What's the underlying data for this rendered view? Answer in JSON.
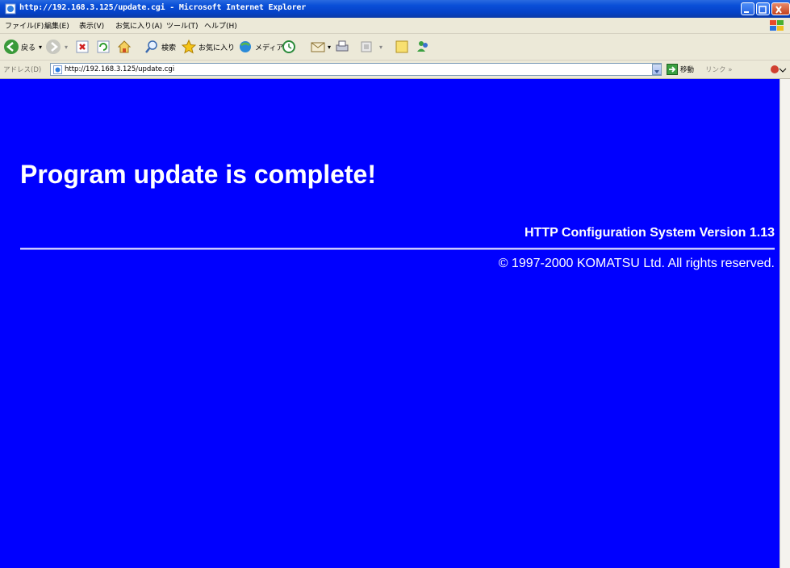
{
  "window": {
    "title": "http://192.168.3.125/update.cgi - Microsoft Internet Explorer"
  },
  "menu": [
    "ファイル(F)",
    "編集(E)",
    "表示(V)",
    "お気に入り(A)",
    "ツール(T)",
    "ヘルプ(H)"
  ],
  "toolbar": {
    "back_label": "戻る",
    "search_label": "検索",
    "favorites_label": "お気に入り",
    "media_label": "メディア"
  },
  "address": {
    "label": "アドレス(D)",
    "url": "http://192.168.3.125/update.cgi",
    "go_label": "移動",
    "links_label": "リンク »"
  },
  "page": {
    "heading": "Program update is complete!",
    "version": "HTTP Configuration System Version 1.13",
    "copyright": "© 1997-2000 KOMATSU Ltd. All rights reserved.",
    "background_color": "#0000ff",
    "text_color": "#ffffff"
  }
}
